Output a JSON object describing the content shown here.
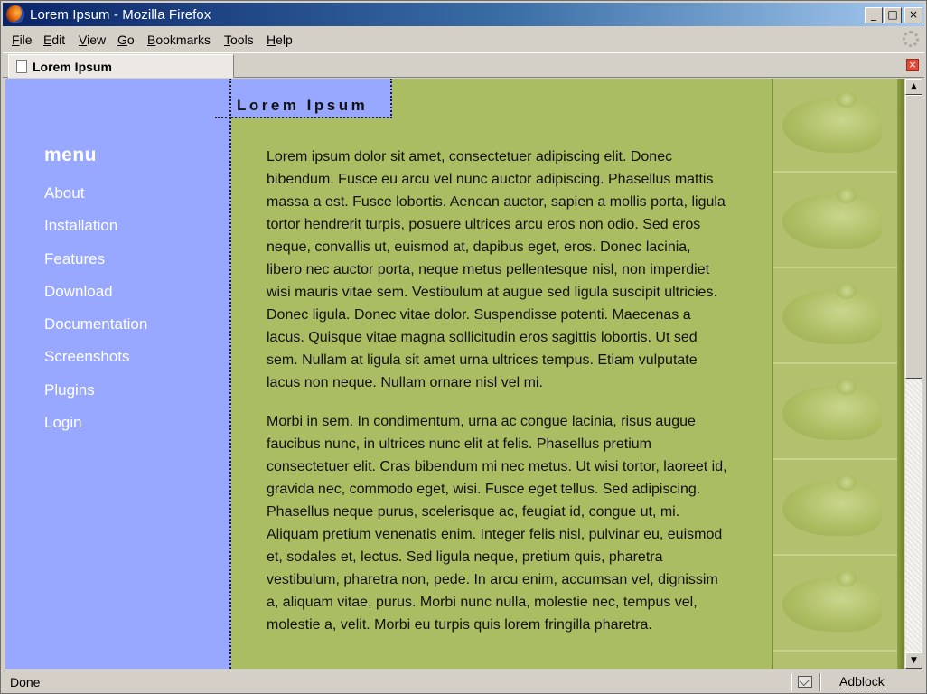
{
  "window": {
    "title": "Lorem Ipsum - Mozilla Firefox",
    "controls": {
      "minimize": "_",
      "maximize": "□",
      "close": "×"
    }
  },
  "menubar": [
    {
      "label": "File",
      "accel": "F"
    },
    {
      "label": "Edit",
      "accel": "E"
    },
    {
      "label": "View",
      "accel": "V"
    },
    {
      "label": "Go",
      "accel": "G"
    },
    {
      "label": "Bookmarks",
      "accel": "B"
    },
    {
      "label": "Tools",
      "accel": "T"
    },
    {
      "label": "Help",
      "accel": "H"
    }
  ],
  "tabs": [
    {
      "label": "Lorem Ipsum",
      "icon": "document-icon",
      "active": true
    }
  ],
  "page": {
    "site_title": "Lorem Ipsum",
    "menu_heading": "menu",
    "nav": [
      "About",
      "Installation",
      "Features",
      "Download",
      "Documentation",
      "Screenshots",
      "Plugins",
      "Login"
    ],
    "paragraphs": [
      "Lorem ipsum dolor sit amet, consectetuer adipiscing elit. Donec bibendum. Fusce eu arcu vel nunc auctor adipiscing. Phasellus mattis massa a est. Fusce lobortis. Aenean auctor, sapien a mollis porta, ligula tortor hendrerit turpis, posuere ultrices arcu eros non odio. Sed eros neque, convallis ut, euismod at, dapibus eget, eros. Donec lacinia, libero nec auctor porta, neque metus pellentesque nisl, non imperdiet wisi mauris vitae sem. Vestibulum at augue sed ligula suscipit ultricies. Donec ligula. Donec vitae dolor. Suspendisse potenti. Maecenas a lacus. Quisque vitae magna sollicitudin eros sagittis lobortis. Ut sed sem. Nullam at ligula sit amet urna ultrices tempus. Etiam vulputate lacus non neque. Nullam ornare nisl vel mi.",
      "Morbi in sem. In condimentum, urna ac congue lacinia, risus augue faucibus nunc, in ultrices nunc elit at felis. Phasellus pretium consectetuer elit. Cras bibendum mi nec metus. Ut wisi tortor, laoreet id, gravida nec, commodo eget, wisi. Fusce eget tellus. Sed adipiscing. Phasellus neque purus, scelerisque ac, feugiat id, congue ut, mi. Aliquam pretium venenatis enim. Integer felis nisl, pulvinar eu, euismod et, sodales et, lectus. Sed ligula neque, pretium quis, pharetra vestibulum, pharetra non, pede. In arcu enim, accumsan vel, dignissim a, aliquam vitae, purus. Morbi nunc nulla, molestie nec, tempus vel, molestie a, velit. Morbi eu turpis quis lorem fringilla pharetra."
    ],
    "colors": {
      "left_panel": "#98a7ff",
      "content_bg": "#abbd63",
      "nav_text": "#ffffff"
    }
  },
  "statusbar": {
    "text": "Done",
    "mail_icon": "mail-icon",
    "extension": "Adblock"
  }
}
